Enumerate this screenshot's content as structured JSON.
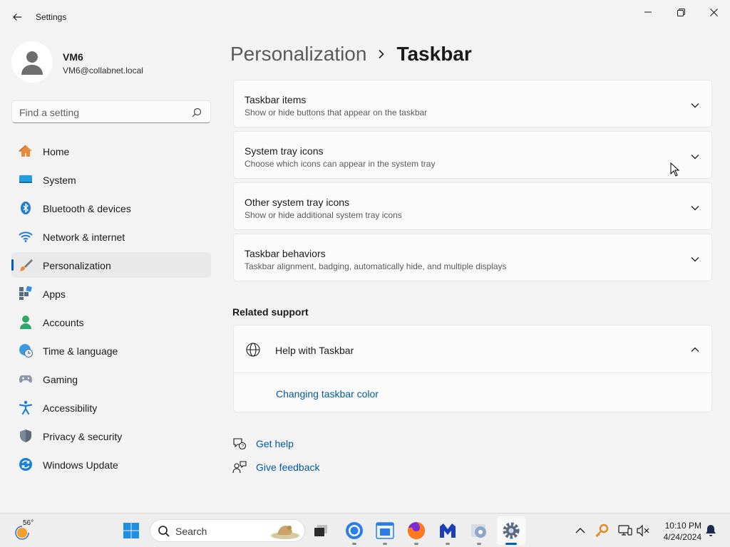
{
  "window": {
    "title": "Settings"
  },
  "profile": {
    "name": "VM6",
    "email": "VM6@collabnet.local"
  },
  "search": {
    "placeholder": "Find a setting"
  },
  "nav": {
    "items": [
      {
        "label": "Home",
        "icon": "home-icon"
      },
      {
        "label": "System",
        "icon": "system-icon"
      },
      {
        "label": "Bluetooth & devices",
        "icon": "bluetooth-icon"
      },
      {
        "label": "Network & internet",
        "icon": "wifi-icon"
      },
      {
        "label": "Personalization",
        "icon": "brush-icon",
        "active": true
      },
      {
        "label": "Apps",
        "icon": "apps-icon"
      },
      {
        "label": "Accounts",
        "icon": "accounts-icon"
      },
      {
        "label": "Time & language",
        "icon": "globe-clock-icon"
      },
      {
        "label": "Gaming",
        "icon": "gamepad-icon"
      },
      {
        "label": "Accessibility",
        "icon": "accessibility-icon"
      },
      {
        "label": "Privacy & security",
        "icon": "shield-icon"
      },
      {
        "label": "Windows Update",
        "icon": "update-icon"
      }
    ]
  },
  "breadcrumb": {
    "parent": "Personalization",
    "current": "Taskbar"
  },
  "cards": [
    {
      "title": "Taskbar items",
      "subtitle": "Show or hide buttons that appear on the taskbar"
    },
    {
      "title": "System tray icons",
      "subtitle": "Choose which icons can appear in the system tray"
    },
    {
      "title": "Other system tray icons",
      "subtitle": "Show or hide additional system tray icons"
    },
    {
      "title": "Taskbar behaviors",
      "subtitle": "Taskbar alignment, badging, automatically hide, and multiple displays"
    }
  ],
  "related": {
    "heading": "Related support",
    "help_title": "Help with Taskbar",
    "help_link": "Changing taskbar color"
  },
  "footer": {
    "get_help": "Get help",
    "give_feedback": "Give feedback"
  },
  "taskbar": {
    "temperature": "56°",
    "search_label": "Search",
    "time": "10:10 PM",
    "date": "4/24/2024"
  },
  "colors": {
    "accent": "#005fb8",
    "link": "#005a9e",
    "background": "#f3f3f3",
    "card": "#fbfbfb"
  }
}
